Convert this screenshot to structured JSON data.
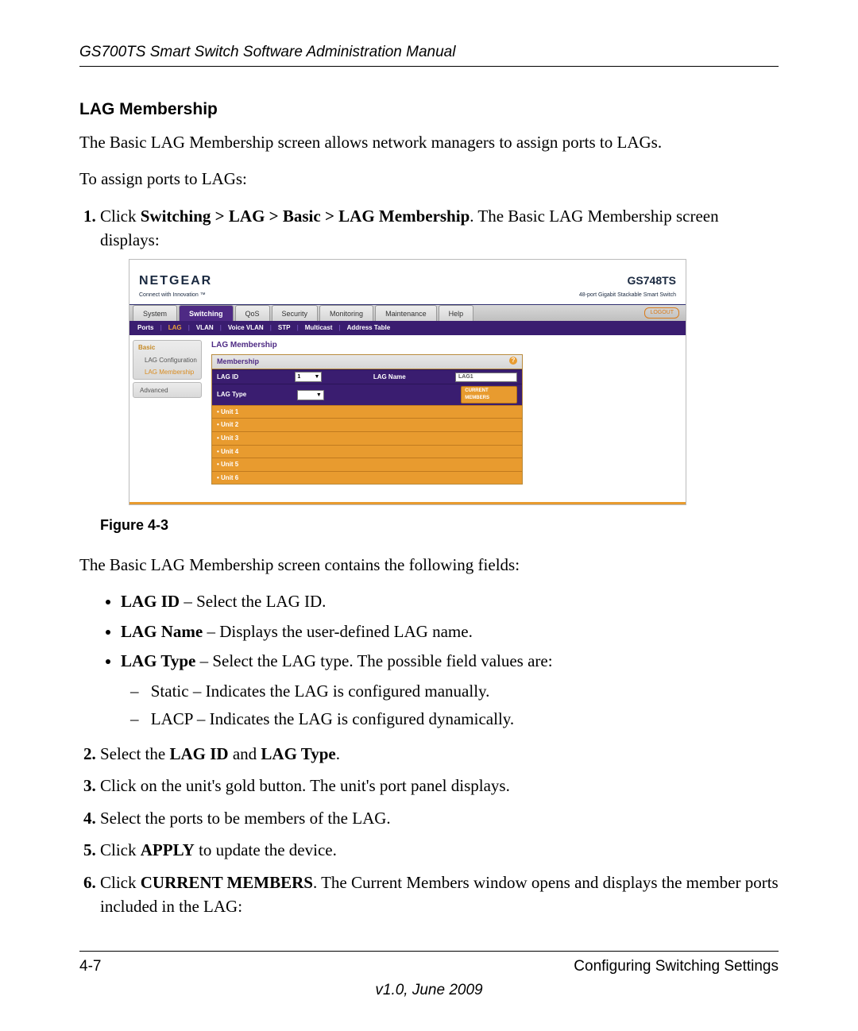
{
  "running_head": "GS700TS Smart Switch Software Administration Manual",
  "section_title": "LAG Membership",
  "intro_para": "The Basic LAG Membership screen allows network managers to assign ports to LAGs.",
  "lead_in": "To assign ports to LAGs:",
  "step1": {
    "prefix": "Click ",
    "path": "Switching > LAG > Basic > LAG Membership",
    "suffix": ". The Basic LAG Membership screen displays:"
  },
  "figure_caption": "Figure 4-3",
  "after_figure": "The Basic LAG Membership screen contains the following fields:",
  "fields": {
    "lag_id": {
      "name": "LAG ID",
      "desc": " – Select the LAG ID."
    },
    "lag_name": {
      "name": "LAG Name",
      "desc": " – Displays the user-defined LAG name."
    },
    "lag_type": {
      "name": "LAG Type",
      "desc": " – Select the LAG type. The possible field values are:"
    },
    "vals": {
      "static": "Static – Indicates the LAG is configured manually.",
      "lacp": "LACP – Indicates the LAG is configured dynamically."
    }
  },
  "step2": {
    "pre": "Select the ",
    "b1": "LAG ID",
    "mid": " and ",
    "b2": "LAG Type",
    "post": "."
  },
  "step3": "Click on the unit's  gold button. The unit's  port panel displays.",
  "step4": "Select the ports to be members of the LAG.",
  "step5": {
    "pre": "Click ",
    "b": "APPLY",
    "post": " to update the device."
  },
  "step6": {
    "pre": "Click ",
    "b": "CURRENT MEMBERS",
    "post": ". The Current Members window opens and displays the member ports included in the LAG:"
  },
  "footer": {
    "page": "4-7",
    "section": "Configuring Switching Settings",
    "version": "v1.0, June 2009"
  },
  "shot": {
    "brand": "NETGEAR",
    "tagline": "Connect with Innovation ™",
    "model": "GS748TS",
    "model_desc": "48-port Gigabit Stackable Smart Switch",
    "logout": "LOGOUT",
    "tabs": [
      "System",
      "Switching",
      "QoS",
      "Security",
      "Monitoring",
      "Maintenance",
      "Help"
    ],
    "active_tab_index": 1,
    "subtabs": [
      "Ports",
      "LAG",
      "VLAN",
      "Voice VLAN",
      "STP",
      "Multicast",
      "Address Table"
    ],
    "active_subtab_index": 1,
    "sidebar": {
      "group_head": "Basic",
      "items": [
        "LAG Configuration",
        "LAG Membership"
      ],
      "active_item_index": 1,
      "advanced": "Advanced"
    },
    "content_title": "LAG Membership",
    "panel_head": "Membership",
    "labels": {
      "lag_id": "LAG ID",
      "lag_name": "LAG Name",
      "lag_type": "LAG Type",
      "lag_id_value": "1",
      "lag_name_value": "LAG1",
      "current_members_btn": "CURRENT MEMBERS"
    },
    "units": [
      "Unit 1",
      "Unit 2",
      "Unit 3",
      "Unit 4",
      "Unit 5",
      "Unit 6"
    ]
  }
}
